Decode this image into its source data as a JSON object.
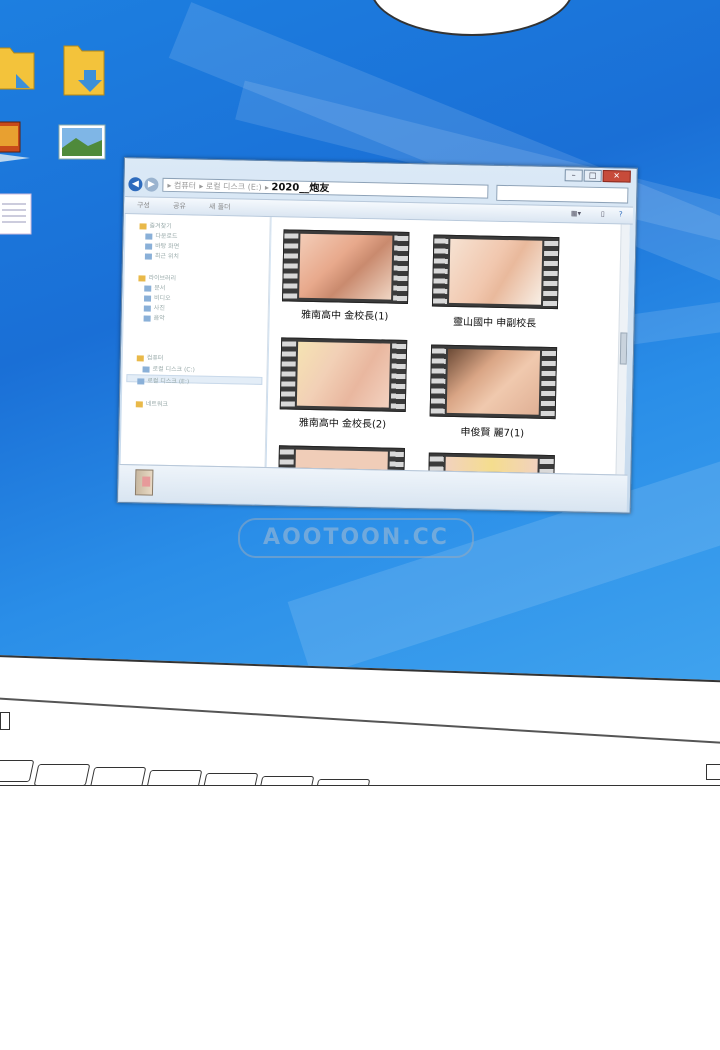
{
  "window": {
    "title_buttons": [
      "–",
      "□",
      "✕"
    ],
    "breadcrumb_blur_1": "컴퓨터",
    "breadcrumb_blur_2": "로컬 디스크 (E:)",
    "current_folder": "2020__炮友",
    "toolbar": {
      "organize": "구성",
      "share": "공유",
      "new_folder": "새 폴더"
    }
  },
  "sidebar": {
    "items": [
      {
        "label": "즐겨찾기",
        "header": true
      },
      {
        "label": "다운로드"
      },
      {
        "label": "바탕 화면"
      },
      {
        "label": "최근 위치"
      },
      {
        "label": "라이브러리",
        "header": true
      },
      {
        "label": "문서"
      },
      {
        "label": "비디오"
      },
      {
        "label": "사진"
      },
      {
        "label": "음악"
      },
      {
        "label": "컴퓨터",
        "header": true
      },
      {
        "label": "로컬 디스크 (C:)"
      },
      {
        "label": "로컬 디스크 (E:)",
        "selected": true
      },
      {
        "label": "네트워크",
        "header": true
      }
    ]
  },
  "files": [
    {
      "name": "雅南高中 金校長(1)"
    },
    {
      "name": "靈山國中 申副校長"
    },
    {
      "name": "雅南高中 金校長(2)"
    },
    {
      "name": "申俊賢 麗7(1)"
    }
  ],
  "watermark": "AOOTOON.CC",
  "colors": {
    "desktop": "#1a6fd6",
    "window_chrome": "#c6d9ec",
    "close_button": "#c74b3a"
  }
}
